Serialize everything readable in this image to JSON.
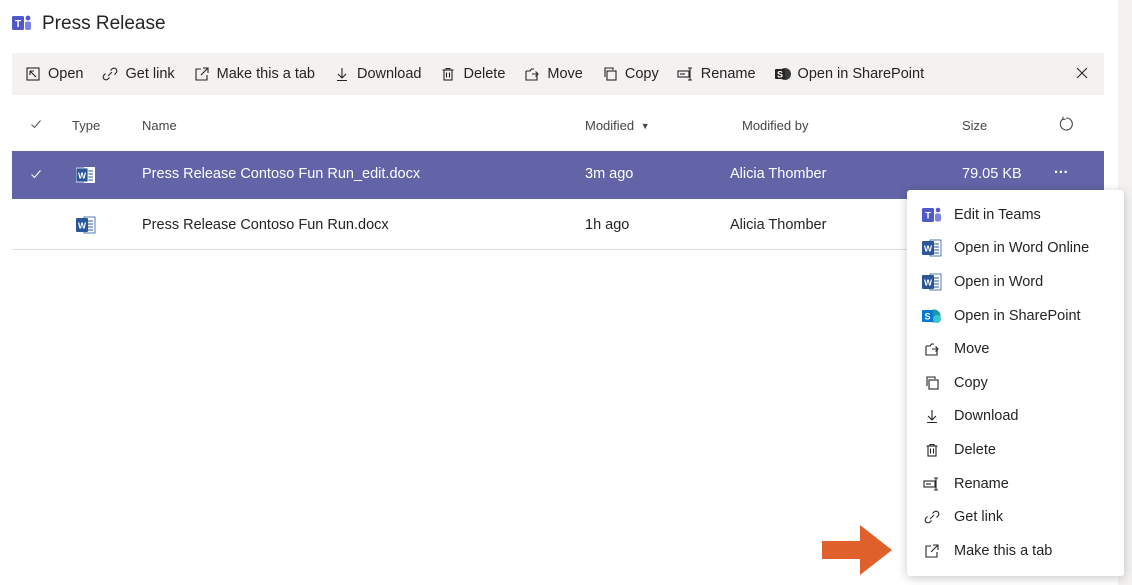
{
  "title": "Press Release",
  "toolbar": {
    "open": "Open",
    "get_link": "Get link",
    "make_tab": "Make this a tab",
    "download": "Download",
    "delete": "Delete",
    "move": "Move",
    "copy": "Copy",
    "rename": "Rename",
    "open_sharepoint": "Open in SharePoint"
  },
  "columns": {
    "type": "Type",
    "name": "Name",
    "modified": "Modified",
    "modified_by": "Modified by",
    "size": "Size"
  },
  "rows": [
    {
      "name": "Press Release Contoso Fun Run_edit.docx",
      "modified": "3m ago",
      "modified_by": "Alicia Thomber",
      "size": "79.05 KB",
      "more": "···"
    },
    {
      "name": "Press Release Contoso Fun Run.docx",
      "modified": "1h ago",
      "modified_by": "Alicia Thomber",
      "size": ""
    }
  ],
  "menu": [
    {
      "label": "Edit in Teams",
      "icon": "teams-icon"
    },
    {
      "label": "Open in Word Online",
      "icon": "word-icon"
    },
    {
      "label": "Open in Word",
      "icon": "word-icon"
    },
    {
      "label": "Open in SharePoint",
      "icon": "sharepoint-icon"
    },
    {
      "label": "Move",
      "icon": "move-icon"
    },
    {
      "label": "Copy",
      "icon": "copy-icon"
    },
    {
      "label": "Download",
      "icon": "download-icon"
    },
    {
      "label": "Delete",
      "icon": "delete-icon"
    },
    {
      "label": "Rename",
      "icon": "rename-icon"
    },
    {
      "label": "Get link",
      "icon": "link-icon"
    },
    {
      "label": "Make this a tab",
      "icon": "make-tab-icon"
    }
  ],
  "colors": {
    "accent": "#6264a7",
    "word_blue": "#2b579a",
    "sharepoint_blue": "#0078d4",
    "arrow": "#e0602b"
  }
}
